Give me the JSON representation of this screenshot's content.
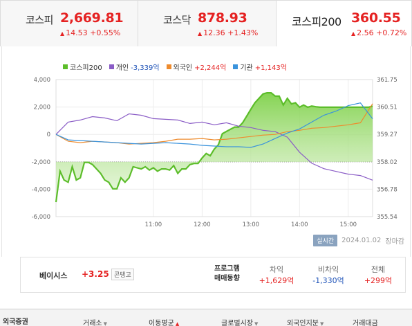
{
  "tabs": [
    {
      "name": "코스피",
      "value": "2,669.81",
      "arrow": "▲",
      "change": "14.53 +0.55%"
    },
    {
      "name": "코스닥",
      "value": "878.93",
      "arrow": "▲",
      "change": "12.36 +1.43%"
    },
    {
      "name": "코스피200",
      "value": "360.55",
      "arrow": "▲",
      "change": "2.56 +0.72%"
    }
  ],
  "colors": {
    "up": "#e52222",
    "down": "#1f53b8",
    "kospi200": "#5cbd2a",
    "individual": "#8a5cc6",
    "foreign": "#ee8b2d",
    "institution": "#3a93dc"
  },
  "legend": [
    {
      "label": "코스피200",
      "value": "",
      "color": "#5cbd2a",
      "dir": ""
    },
    {
      "label": "개인",
      "value": "-3,339억",
      "color": "#8a5cc6",
      "dir": "down"
    },
    {
      "label": "외국인",
      "value": "+2,244억",
      "color": "#ee8b2d",
      "dir": "up"
    },
    {
      "label": "기관",
      "value": "+1,143억",
      "color": "#3a93dc",
      "dir": "up"
    }
  ],
  "chart_data": {
    "type": "line",
    "x_ticks": [
      "11:00",
      "12:00",
      "13:00",
      "14:00",
      "15:00"
    ],
    "y_left_ticks": [
      "4,000",
      "2,000",
      "0",
      "-2,000",
      "-4,000",
      "-6,000"
    ],
    "y_left_range": [
      -6000,
      4000
    ],
    "y_right_ticks": [
      "361.75",
      "360.51",
      "359.27",
      "358.02",
      "356.78",
      "355.54"
    ],
    "y_right_range": [
      355.54,
      361.75
    ],
    "reference_line_right": 358.02,
    "x_range": [
      "09:00",
      "15:30"
    ],
    "series": [
      {
        "name": "코스피200",
        "axis": "right",
        "style": "area",
        "color": "#5cbd2a",
        "x": [
          "09:00",
          "09:05",
          "09:10",
          "09:15",
          "09:20",
          "09:25",
          "09:30",
          "09:35",
          "09:40",
          "09:45",
          "09:50",
          "09:55",
          "10:00",
          "10:05",
          "10:10",
          "10:15",
          "10:20",
          "10:25",
          "10:30",
          "10:35",
          "10:40",
          "10:45",
          "10:50",
          "10:55",
          "11:00",
          "11:05",
          "11:10",
          "11:15",
          "11:20",
          "11:25",
          "11:30",
          "11:35",
          "11:40",
          "11:45",
          "11:50",
          "11:55",
          "12:00",
          "12:05",
          "12:10",
          "12:15",
          "12:20",
          "12:25",
          "12:30",
          "12:35",
          "12:40",
          "12:45",
          "12:50",
          "12:55",
          "13:00",
          "13:05",
          "13:10",
          "13:15",
          "13:20",
          "13:25",
          "13:30",
          "13:35",
          "13:40",
          "13:45",
          "13:50",
          "13:55",
          "14:00",
          "14:05",
          "14:10",
          "14:15",
          "14:20",
          "14:25",
          "14:30",
          "14:35",
          "14:40",
          "14:45",
          "14:50",
          "14:55",
          "15:00",
          "15:05",
          "15:10",
          "15:15",
          "15:20",
          "15:25",
          "15:30"
        ],
        "values": [
          356.2,
          357.6,
          357.2,
          357.1,
          357.8,
          357.2,
          357.3,
          358.0,
          358.0,
          357.9,
          357.7,
          357.5,
          357.2,
          357.1,
          356.8,
          356.8,
          357.3,
          357.1,
          357.3,
          357.8,
          357.75,
          357.7,
          357.8,
          357.65,
          357.75,
          357.6,
          357.7,
          357.7,
          357.65,
          357.85,
          357.5,
          357.7,
          357.7,
          357.9,
          357.95,
          357.95,
          358.2,
          358.4,
          358.3,
          358.6,
          358.8,
          359.3,
          359.4,
          359.5,
          359.6,
          359.6,
          359.8,
          360.1,
          360.4,
          360.7,
          360.9,
          361.1,
          361.15,
          361.15,
          361.0,
          361.0,
          360.6,
          360.9,
          360.65,
          360.7,
          360.5,
          360.6,
          360.5,
          360.55,
          360.52,
          360.5,
          360.5,
          360.5,
          360.5,
          360.5,
          360.5,
          360.5,
          360.5,
          360.5,
          360.5,
          360.5,
          360.5,
          360.5,
          360.55
        ]
      },
      {
        "name": "개인",
        "axis": "left",
        "color": "#8a5cc6",
        "x": [
          "09:00",
          "09:15",
          "09:30",
          "09:45",
          "10:00",
          "10:15",
          "10:30",
          "10:45",
          "11:00",
          "11:15",
          "11:30",
          "11:45",
          "12:00",
          "12:15",
          "12:30",
          "12:45",
          "13:00",
          "13:15",
          "13:30",
          "13:45",
          "14:00",
          "14:15",
          "14:30",
          "14:45",
          "15:00",
          "15:15",
          "15:30"
        ],
        "values": [
          0,
          900,
          1050,
          1300,
          1200,
          1000,
          1500,
          1400,
          1150,
          1100,
          1050,
          800,
          900,
          700,
          850,
          600,
          500,
          300,
          200,
          -200,
          -1300,
          -2100,
          -2500,
          -2700,
          -2900,
          -3000,
          -3339
        ]
      },
      {
        "name": "외국인",
        "axis": "left",
        "color": "#ee8b2d",
        "x": [
          "09:00",
          "09:15",
          "09:30",
          "09:45",
          "10:00",
          "10:15",
          "10:30",
          "10:45",
          "11:00",
          "11:15",
          "11:30",
          "11:45",
          "12:00",
          "12:15",
          "12:30",
          "12:45",
          "13:00",
          "13:15",
          "13:30",
          "13:45",
          "14:00",
          "14:15",
          "14:30",
          "14:45",
          "15:00",
          "15:15",
          "15:30"
        ],
        "values": [
          0,
          -500,
          -600,
          -500,
          -550,
          -600,
          -700,
          -650,
          -600,
          -500,
          -350,
          -350,
          -300,
          -400,
          -350,
          -250,
          -150,
          -50,
          0,
          200,
          300,
          450,
          500,
          600,
          700,
          850,
          2244
        ]
      },
      {
        "name": "기관",
        "axis": "left",
        "color": "#3a93dc",
        "x": [
          "09:00",
          "09:15",
          "09:30",
          "09:45",
          "10:00",
          "10:15",
          "10:30",
          "10:45",
          "11:00",
          "11:15",
          "11:30",
          "11:45",
          "12:00",
          "12:15",
          "12:30",
          "12:45",
          "13:00",
          "13:15",
          "13:30",
          "13:45",
          "14:00",
          "14:15",
          "14:30",
          "14:45",
          "15:00",
          "15:15",
          "15:30"
        ],
        "values": [
          0,
          -400,
          -450,
          -500,
          -550,
          -600,
          -650,
          -700,
          -650,
          -600,
          -650,
          -700,
          -800,
          -850,
          -900,
          -900,
          -950,
          -700,
          -300,
          100,
          400,
          900,
          1400,
          1700,
          2100,
          2300,
          1143
        ]
      }
    ]
  },
  "status": {
    "badge": "실시간",
    "date": "2024.01.02",
    "state": "장마감"
  },
  "basis": {
    "label": "베이시스",
    "value": "+3.25",
    "state": "콘탱고",
    "program_line1": "프로그램",
    "program_line2": "매매동향",
    "cols": [
      {
        "header": "차익",
        "value": "+1,629억",
        "dir": "up"
      },
      {
        "header": "비차익",
        "value": "-1,330억",
        "dir": "down"
      },
      {
        "header": "전체",
        "value": "+299억",
        "dir": "up"
      }
    ]
  },
  "bottom": {
    "title": "외국증권",
    "items": [
      "거래소",
      "이동평균",
      "글로벌시장",
      "외국인지분",
      "거래대금"
    ]
  }
}
